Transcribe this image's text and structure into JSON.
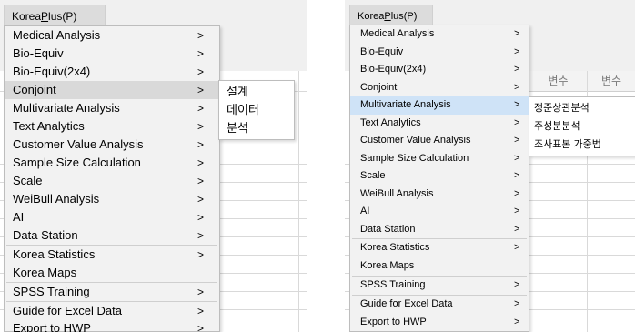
{
  "left": {
    "menubar": {
      "pre": "Korea",
      "mnemonic": "P",
      "post": "lus(P)"
    },
    "menu_items": [
      "Medical Analysis",
      "Bio-Equiv",
      "Bio-Equiv(2x4)",
      "Conjoint",
      "Multivariate Analysis",
      "Text Analytics",
      "Customer Value Analysis",
      "Sample Size Calculation",
      "Scale",
      "WeiBull Analysis",
      "AI",
      "Data Station",
      "Korea Statistics",
      "Korea Maps",
      "SPSS Training",
      "Guide for Excel Data",
      "Export to HWP"
    ],
    "arrow": ">",
    "active_item": "Conjoint",
    "submenu": [
      "설계",
      "데이터",
      "분석"
    ]
  },
  "right": {
    "menubar": {
      "pre": "Korea",
      "mnemonic": "P",
      "post": "lus(P)"
    },
    "menu_items": [
      "Medical Analysis",
      "Bio-Equiv",
      "Bio-Equiv(2x4)",
      "Conjoint",
      "Multivariate Analysis",
      "Text Analytics",
      "Customer Value Analysis",
      "Sample Size Calculation",
      "Scale",
      "WeiBull Analysis",
      "AI",
      "Data Station",
      "Korea Statistics",
      "Korea Maps",
      "SPSS Training",
      "Guide for Excel Data",
      "Export to HWP"
    ],
    "arrow": ">",
    "active_item": "Multivariate Analysis",
    "submenu": [
      "정준상관분석",
      "주성분분석",
      "조사표본 가중법"
    ],
    "column_headers": [
      "변수",
      "변수"
    ]
  },
  "colors": {
    "highlight_blue": "#cfe3f7",
    "highlight_gray": "#d9d9d9",
    "menu_bg": "#f2f2f2"
  }
}
